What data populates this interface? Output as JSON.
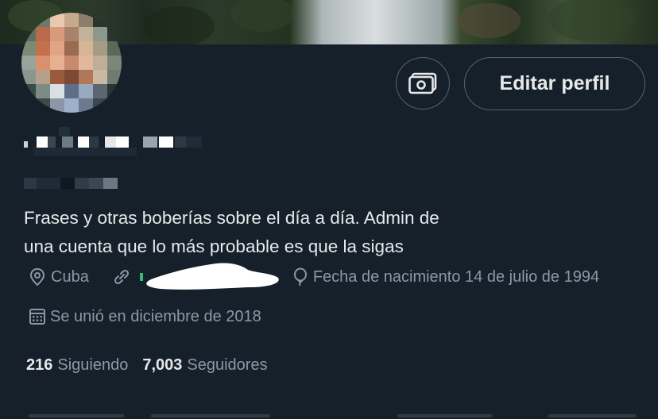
{
  "header": {
    "camera_icon": "camera-money-icon",
    "edit_profile_label": "Editar perfil"
  },
  "profile": {
    "bio_line_1": "Frases y otras boberías sobre el día a día. Admin de",
    "bio_line_2": "una cuenta que lo más probable es que la sigas",
    "location": "Cuba",
    "location_icon": "location-pin-icon",
    "link_icon": "link-icon",
    "birthday": "Fecha de nacimiento 14 de julio de 1994",
    "birthday_icon": "balloon-icon",
    "joined": "Se unió en diciembre de 2018",
    "joined_icon": "calendar-icon"
  },
  "stats": {
    "following_count": "216",
    "following_label": "Siguiendo",
    "followers_count": "7,003",
    "followers_label": "Seguidores"
  },
  "colors": {
    "background": "#15202b",
    "text_primary": "#e7e9ea",
    "text_secondary": "#8b98a5",
    "border": "#536471"
  }
}
